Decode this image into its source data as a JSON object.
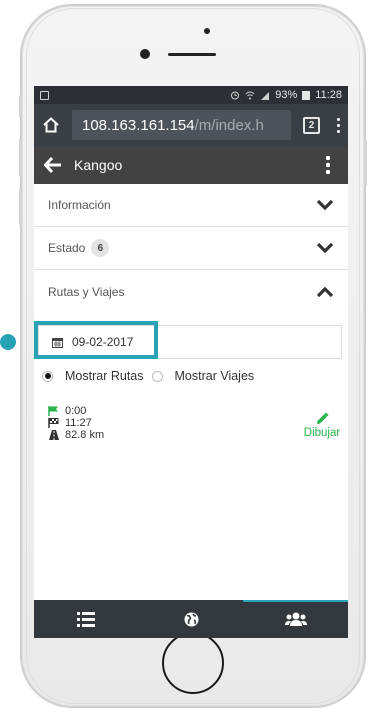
{
  "statusbar": {
    "battery": "93%",
    "time": "11:28"
  },
  "browser": {
    "url_host": "108.163.161.154",
    "url_path": "/m/index.h",
    "tab_count": "2"
  },
  "appbar": {
    "title": "Kangoo"
  },
  "accordion": {
    "informacion": "Información",
    "estado": "Estado",
    "estado_count": "6",
    "rutas": "Rutas y Viajes"
  },
  "date_filter": {
    "value": "09-02-2017"
  },
  "options": {
    "mostrar_rutas": "Mostrar Rutas",
    "mostrar_viajes": "Mostrar Viajes",
    "selected": "mostrar_rutas"
  },
  "route_info": {
    "start_time": "0:00",
    "end_time": "11:27",
    "distance": "82.8 km"
  },
  "actions": {
    "draw_label": "Dibujar"
  },
  "colors": {
    "accent": "#28a3b6",
    "draw_green": "#27b24a",
    "appbar": "#424242",
    "nav": "#33383e"
  },
  "icons": {
    "back": "arrow-left-icon",
    "calendar": "calendar-icon",
    "flag_start": "flag-icon",
    "flag_end": "checkered-flag-icon",
    "road": "road-icon",
    "pencil": "pencil-icon",
    "list": "list-icon",
    "globe": "globe-icon",
    "users": "users-icon"
  }
}
